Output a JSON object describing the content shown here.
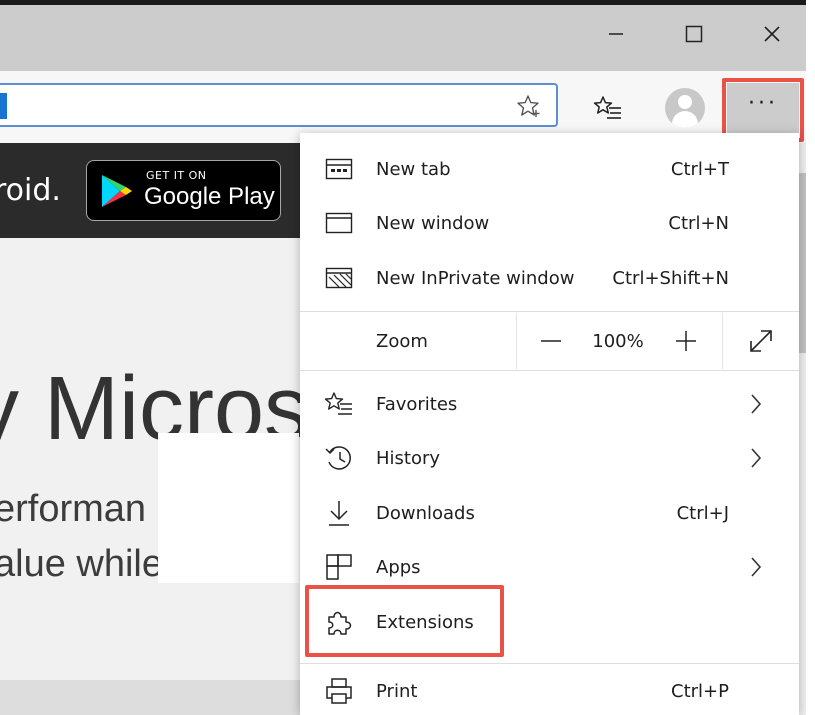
{
  "window": {
    "controls": [
      {
        "name": "minimize",
        "icon": "minimize-icon"
      },
      {
        "name": "maximize",
        "icon": "maximize-icon"
      },
      {
        "name": "close",
        "icon": "close-icon"
      }
    ]
  },
  "toolbar": {
    "address_value": "",
    "icons": [
      "add-to-favorites-star-icon",
      "favorites-list-icon",
      "profile-avatar-icon",
      "more-options-icon"
    ],
    "more_label": "···"
  },
  "page": {
    "banner_text": "roid.",
    "store_badge": {
      "small": "GET IT ON",
      "big": "Google Play"
    },
    "hero": "y Micros",
    "sub1": "erforman",
    "sub2": "alue while"
  },
  "menu": {
    "items_top": [
      {
        "label": "New tab",
        "shortcut": "Ctrl+T",
        "icon": "new-tab-icon"
      },
      {
        "label": "New window",
        "shortcut": "Ctrl+N",
        "icon": "new-window-icon"
      },
      {
        "label": "New InPrivate window",
        "shortcut": "Ctrl+Shift+N",
        "icon": "inprivate-icon"
      }
    ],
    "zoom": {
      "label": "Zoom",
      "minus": "—",
      "value": "100%",
      "plus": "+",
      "icons": [
        "zoom-out-icon",
        "zoom-in-icon",
        "fullscreen-icon"
      ]
    },
    "items_bottom": [
      {
        "label": "Favorites",
        "shortcut": "",
        "icon": "favorites-icon",
        "submenu": true
      },
      {
        "label": "History",
        "shortcut": "",
        "icon": "history-icon",
        "submenu": true
      },
      {
        "label": "Downloads",
        "shortcut": "Ctrl+J",
        "icon": "download-icon",
        "submenu": false
      },
      {
        "label": "Apps",
        "shortcut": "",
        "icon": "apps-icon",
        "submenu": true
      },
      {
        "label": "Extensions",
        "shortcut": "",
        "icon": "extensions-puzzle-icon",
        "submenu": false
      }
    ],
    "print": {
      "label": "Print",
      "shortcut": "Ctrl+P",
      "icon": "print-icon"
    }
  },
  "highlight_color": "#ea5248"
}
